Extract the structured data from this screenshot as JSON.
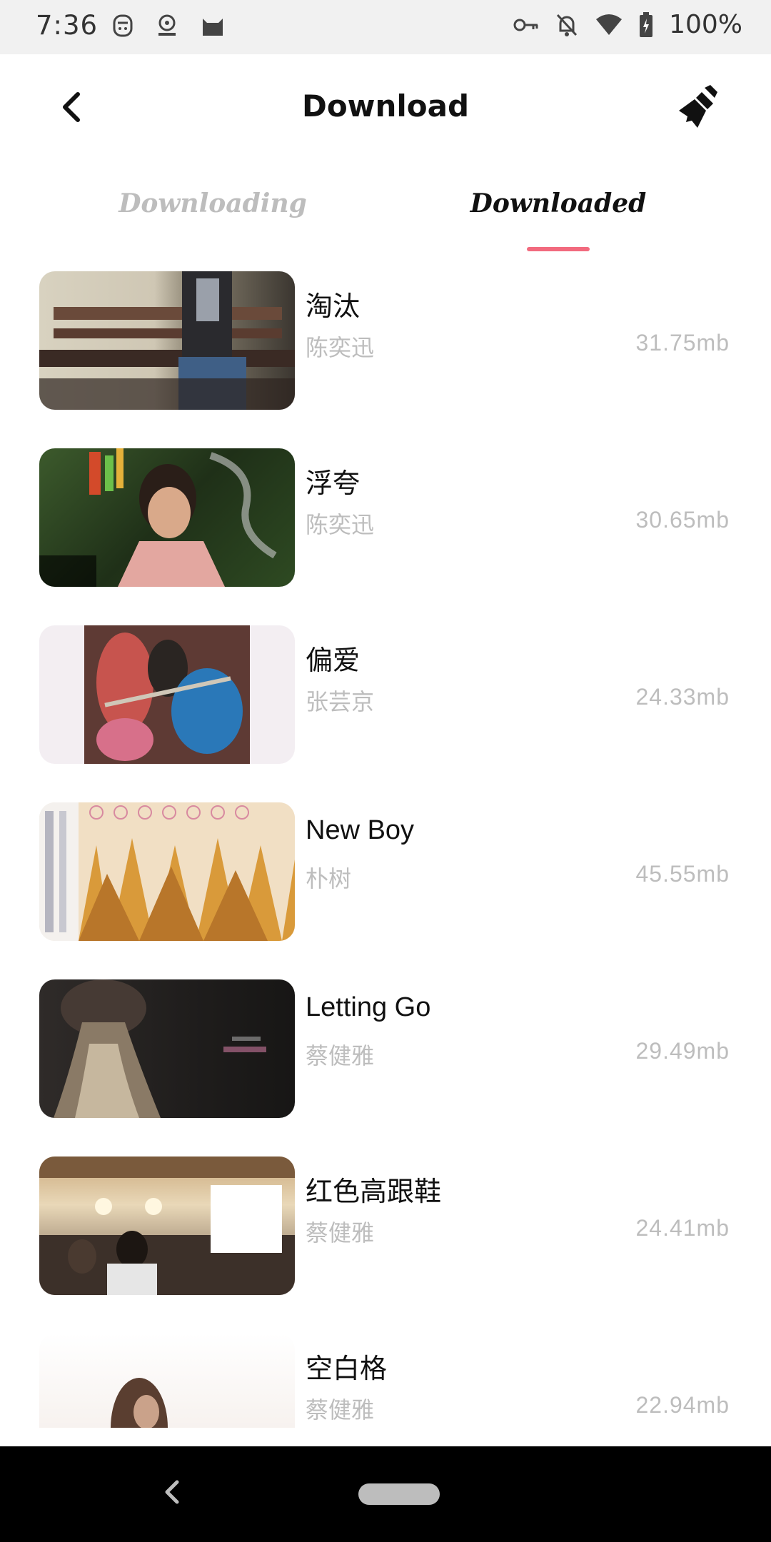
{
  "status_bar": {
    "time": "7:36",
    "battery": "100%",
    "icons": [
      "face-icon",
      "radio-icon",
      "cat-icon",
      "key-icon",
      "bell-off-icon",
      "wifi-icon",
      "battery-icon"
    ]
  },
  "header": {
    "title": "Download",
    "back_icon": "back-arrow-icon",
    "clean_icon": "broom-icon"
  },
  "tabs": {
    "items": [
      {
        "label": "Downloading",
        "active": false
      },
      {
        "label": "Downloaded",
        "active": true
      }
    ],
    "accent_color": "#f26a7e"
  },
  "downloads": [
    {
      "title": "淘汰",
      "artist": "陈奕迅",
      "size": "31.75mb"
    },
    {
      "title": "浮夸",
      "artist": "陈奕迅",
      "size": "30.65mb"
    },
    {
      "title": "偏爱",
      "artist": "张芸京",
      "size": "24.33mb"
    },
    {
      "title": "New Boy",
      "artist": "朴树",
      "size": "45.55mb"
    },
    {
      "title": "Letting Go",
      "artist": "蔡健雅",
      "size": "29.49mb"
    },
    {
      "title": "红色高跟鞋",
      "artist": "蔡健雅",
      "size": "24.41mb"
    },
    {
      "title": "空白格",
      "artist": "蔡健雅",
      "size": "22.94mb"
    }
  ],
  "nav_bar": {
    "back_icon": "nav-back-icon",
    "home_icon": "nav-home-pill"
  }
}
